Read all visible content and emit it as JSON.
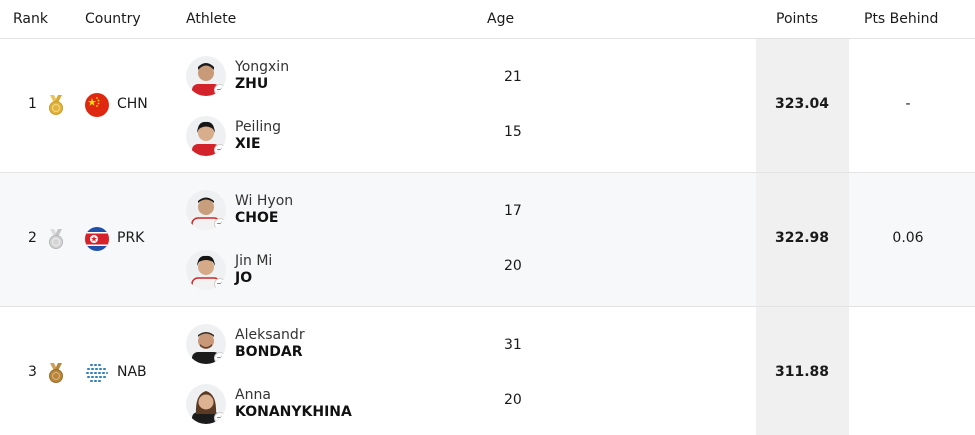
{
  "headers": {
    "rank": "Rank",
    "country": "Country",
    "athlete": "Athlete",
    "age": "Age",
    "points": "Points",
    "pts_behind": "Pts Behind"
  },
  "rows": [
    {
      "rank": "1",
      "medal": "gold",
      "country_code": "CHN",
      "flag": "china-flag",
      "points": "323.04",
      "pts_behind": "-",
      "athletes": [
        {
          "first": "Yongxin",
          "last": "ZHU",
          "age": "21"
        },
        {
          "first": "Peiling",
          "last": "XIE",
          "age": "15"
        }
      ]
    },
    {
      "rank": "2",
      "medal": "silver",
      "country_code": "PRK",
      "flag": "north-korea-flag",
      "points": "322.98",
      "pts_behind": "0.06",
      "athletes": [
        {
          "first": "Wi Hyon",
          "last": "CHOE",
          "age": "17"
        },
        {
          "first": "Jin Mi",
          "last": "JO",
          "age": "20"
        }
      ]
    },
    {
      "rank": "3",
      "medal": "bronze",
      "country_code": "NAB",
      "flag": "neutral-athletes-flag",
      "points": "311.88",
      "pts_behind": "",
      "athletes": [
        {
          "first": "Aleksandr",
          "last": "BONDAR",
          "age": "31"
        },
        {
          "first": "Anna",
          "last": "KONANYKHINA",
          "age": "20"
        }
      ]
    }
  ],
  "colors": {
    "gold": "#e2b33c",
    "silver": "#c9c9c9",
    "bronze": "#b8863b",
    "china_red": "#de2910",
    "prk_blue": "#1f4fa8",
    "prk_red": "#d6232a",
    "nab_blue": "#2d7fc1"
  }
}
